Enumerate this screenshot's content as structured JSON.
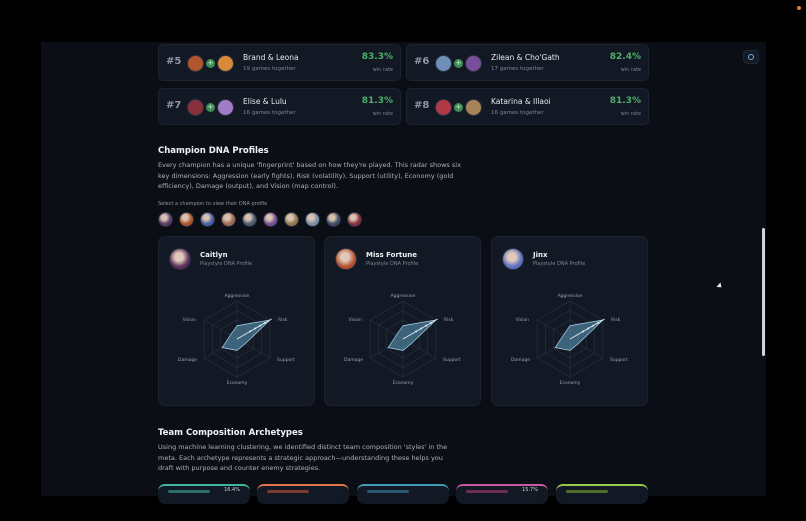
{
  "pairs": [
    {
      "rank": "#5",
      "names": "Brand & Leona",
      "games": "19 games together",
      "win_rate": "83.3%",
      "win_label": "win rate",
      "colors": [
        "#b0552d",
        "#d88a3a"
      ]
    },
    {
      "rank": "#6",
      "names": "Zilean & Cho'Gath",
      "games": "17 games together",
      "win_rate": "82.4%",
      "win_label": "win rate",
      "colors": [
        "#6f8fb8",
        "#7a4f9a"
      ]
    },
    {
      "rank": "#7",
      "names": "Elise & Lulu",
      "games": "16 games together",
      "win_rate": "81.3%",
      "win_label": "win rate",
      "colors": [
        "#8a2f3c",
        "#a27cc8"
      ]
    },
    {
      "rank": "#8",
      "names": "Katarina & Illaoi",
      "games": "16 games together",
      "win_rate": "81.3%",
      "win_label": "win rate",
      "colors": [
        "#b23a46",
        "#a68458"
      ]
    }
  ],
  "dna_section": {
    "title": "Champion DNA Profiles",
    "description": "Every champion has a unique 'fingerprint' based on how they're played. This radar shows six key dimensions: Aggression (early fights), Risk (volatility), Support (utility), Economy (gold efficiency), Damage (output), and Vision (map control).",
    "select_hint": "Select a champion to view their DNA profile",
    "champion_colors": [
      "#5a3a66",
      "#b0552d",
      "#4a5fa8",
      "#a06a50",
      "#4d5d6e",
      "#7a4f9a",
      "#8c7a4a",
      "#7b8ea8",
      "#3e4e66",
      "#8a3040"
    ]
  },
  "dna_cards": [
    {
      "name": "Caitlyn",
      "subtitle": "Playstyle DNA Profile",
      "avatar_color": "#5a2d5a"
    },
    {
      "name": "Miss Fortune",
      "subtitle": "Playstyle DNA Profile",
      "avatar_color": "#b3502c"
    },
    {
      "name": "Jinx",
      "subtitle": "Playstyle DNA Profile",
      "avatar_color": "#5c6fc0"
    }
  ],
  "radar_axes": [
    "Aggression",
    "Risk",
    "Support",
    "Economy",
    "Damage",
    "Vision"
  ],
  "archetypes_section": {
    "title": "Team Composition Archetypes",
    "description": "Using machine learning clustering, we identified distinct team composition 'styles' in the meta. Each archetype represents a strategic approach—understanding these helps you draft with purpose and counter enemy strategies."
  },
  "archetype_cards": [
    {
      "accent": "#3fb59a",
      "bar": "#2b6e66",
      "value": "16.4%"
    },
    {
      "accent": "#e0744a",
      "bar": "#7a3b2e",
      "value": ""
    },
    {
      "accent": "#3f9bb5",
      "bar": "#2b5a6e",
      "value": ""
    },
    {
      "accent": "#c75aa0",
      "bar": "#6e2b55",
      "value": "15.7%"
    },
    {
      "accent": "#9ac94a",
      "bar": "#4f6e2b",
      "value": ""
    }
  ],
  "theme": {
    "background": "#0b0e14",
    "card": "#121824",
    "positive": "#4caf6a",
    "radar_fill": "#5e9fc0"
  }
}
